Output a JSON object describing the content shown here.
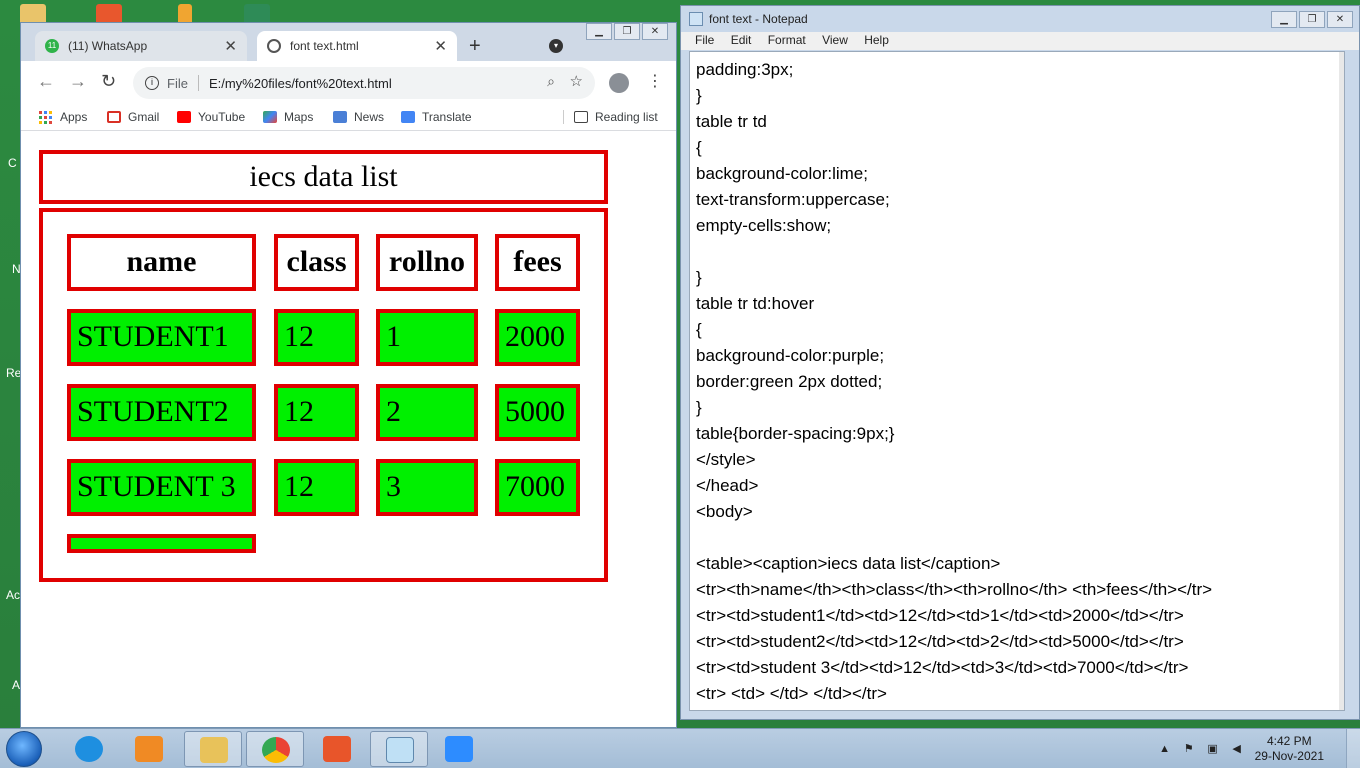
{
  "desktop": {
    "labels": [
      "C",
      "N",
      "Re",
      "Ac",
      "A"
    ]
  },
  "chrome": {
    "tabs": [
      {
        "label": "(11) WhatsApp",
        "badge": "11",
        "close": "✕",
        "active": false
      },
      {
        "label": "font text.html",
        "close": "✕",
        "active": true
      }
    ],
    "new_tab": "+",
    "address": {
      "scheme_label": "File",
      "url": "E:/my%20files/font%20text.html"
    },
    "bookmarks": [
      "Apps",
      "Gmail",
      "YouTube",
      "Maps",
      "News",
      "Translate"
    ],
    "reading_list": "Reading list",
    "page": {
      "caption": "iecs data list",
      "headers": [
        "name",
        "class",
        "rollno",
        "fees"
      ],
      "rows": [
        [
          "STUDENT1",
          "12",
          "1",
          "2000"
        ],
        [
          "STUDENT2",
          "12",
          "2",
          "5000"
        ],
        [
          "STUDENT 3",
          "12",
          "3",
          "7000"
        ],
        [
          ""
        ]
      ]
    },
    "colors": {
      "border": "#e00000",
      "cell_bg": "#00f000"
    }
  },
  "notepad": {
    "title": "font text - Notepad",
    "menu": [
      "File",
      "Edit",
      "Format",
      "View",
      "Help"
    ],
    "lines": [
      "padding:3px;",
      "}",
      "table tr td",
      "{",
      "background-color:lime;",
      "text-transform:uppercase;",
      "empty-cells:show;",
      "",
      "}",
      "table tr td:hover",
      "{",
      "background-color:purple;",
      "border:green 2px dotted;",
      "}",
      "table{border-spacing:9px;}",
      "</style>",
      "</head>",
      "<body>",
      "",
      "<table><caption>iecs data list</caption>",
      "<tr><th>name</th><th>class</th><th>rollno</th> <th>fees</th></tr>",
      "<tr><td>student1</td><td>12</td><td>1</td><td>2000</td></tr>",
      "<tr><td>student2</td><td>12</td><td>2</td><td>5000</td></tr>",
      "<tr><td>student 3</td><td>12</td><td>3</td><td>7000</td></tr>",
      "<tr> <td> </td> </td></tr>"
    ]
  },
  "taskbar": {
    "apps": [
      "internet-explorer",
      "media-player",
      "file-explorer",
      "chrome",
      "brave",
      "notepad",
      "zoom"
    ],
    "time": "4:42 PM",
    "date": "29-Nov-2021"
  }
}
